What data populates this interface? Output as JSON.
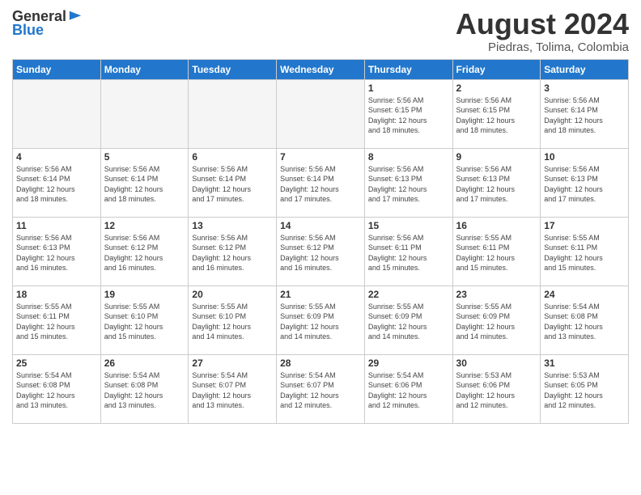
{
  "logo": {
    "general": "General",
    "blue": "Blue"
  },
  "header": {
    "month": "August 2024",
    "location": "Piedras, Tolima, Colombia"
  },
  "weekdays": [
    "Sunday",
    "Monday",
    "Tuesday",
    "Wednesday",
    "Thursday",
    "Friday",
    "Saturday"
  ],
  "weeks": [
    [
      {
        "day": "",
        "info": ""
      },
      {
        "day": "",
        "info": ""
      },
      {
        "day": "",
        "info": ""
      },
      {
        "day": "",
        "info": ""
      },
      {
        "day": "1",
        "info": "Sunrise: 5:56 AM\nSunset: 6:15 PM\nDaylight: 12 hours\nand 18 minutes."
      },
      {
        "day": "2",
        "info": "Sunrise: 5:56 AM\nSunset: 6:15 PM\nDaylight: 12 hours\nand 18 minutes."
      },
      {
        "day": "3",
        "info": "Sunrise: 5:56 AM\nSunset: 6:14 PM\nDaylight: 12 hours\nand 18 minutes."
      }
    ],
    [
      {
        "day": "4",
        "info": "Sunrise: 5:56 AM\nSunset: 6:14 PM\nDaylight: 12 hours\nand 18 minutes."
      },
      {
        "day": "5",
        "info": "Sunrise: 5:56 AM\nSunset: 6:14 PM\nDaylight: 12 hours\nand 18 minutes."
      },
      {
        "day": "6",
        "info": "Sunrise: 5:56 AM\nSunset: 6:14 PM\nDaylight: 12 hours\nand 17 minutes."
      },
      {
        "day": "7",
        "info": "Sunrise: 5:56 AM\nSunset: 6:14 PM\nDaylight: 12 hours\nand 17 minutes."
      },
      {
        "day": "8",
        "info": "Sunrise: 5:56 AM\nSunset: 6:13 PM\nDaylight: 12 hours\nand 17 minutes."
      },
      {
        "day": "9",
        "info": "Sunrise: 5:56 AM\nSunset: 6:13 PM\nDaylight: 12 hours\nand 17 minutes."
      },
      {
        "day": "10",
        "info": "Sunrise: 5:56 AM\nSunset: 6:13 PM\nDaylight: 12 hours\nand 17 minutes."
      }
    ],
    [
      {
        "day": "11",
        "info": "Sunrise: 5:56 AM\nSunset: 6:13 PM\nDaylight: 12 hours\nand 16 minutes."
      },
      {
        "day": "12",
        "info": "Sunrise: 5:56 AM\nSunset: 6:12 PM\nDaylight: 12 hours\nand 16 minutes."
      },
      {
        "day": "13",
        "info": "Sunrise: 5:56 AM\nSunset: 6:12 PM\nDaylight: 12 hours\nand 16 minutes."
      },
      {
        "day": "14",
        "info": "Sunrise: 5:56 AM\nSunset: 6:12 PM\nDaylight: 12 hours\nand 16 minutes."
      },
      {
        "day": "15",
        "info": "Sunrise: 5:56 AM\nSunset: 6:11 PM\nDaylight: 12 hours\nand 15 minutes."
      },
      {
        "day": "16",
        "info": "Sunrise: 5:55 AM\nSunset: 6:11 PM\nDaylight: 12 hours\nand 15 minutes."
      },
      {
        "day": "17",
        "info": "Sunrise: 5:55 AM\nSunset: 6:11 PM\nDaylight: 12 hours\nand 15 minutes."
      }
    ],
    [
      {
        "day": "18",
        "info": "Sunrise: 5:55 AM\nSunset: 6:11 PM\nDaylight: 12 hours\nand 15 minutes."
      },
      {
        "day": "19",
        "info": "Sunrise: 5:55 AM\nSunset: 6:10 PM\nDaylight: 12 hours\nand 15 minutes."
      },
      {
        "day": "20",
        "info": "Sunrise: 5:55 AM\nSunset: 6:10 PM\nDaylight: 12 hours\nand 14 minutes."
      },
      {
        "day": "21",
        "info": "Sunrise: 5:55 AM\nSunset: 6:09 PM\nDaylight: 12 hours\nand 14 minutes."
      },
      {
        "day": "22",
        "info": "Sunrise: 5:55 AM\nSunset: 6:09 PM\nDaylight: 12 hours\nand 14 minutes."
      },
      {
        "day": "23",
        "info": "Sunrise: 5:55 AM\nSunset: 6:09 PM\nDaylight: 12 hours\nand 14 minutes."
      },
      {
        "day": "24",
        "info": "Sunrise: 5:54 AM\nSunset: 6:08 PM\nDaylight: 12 hours\nand 13 minutes."
      }
    ],
    [
      {
        "day": "25",
        "info": "Sunrise: 5:54 AM\nSunset: 6:08 PM\nDaylight: 12 hours\nand 13 minutes."
      },
      {
        "day": "26",
        "info": "Sunrise: 5:54 AM\nSunset: 6:08 PM\nDaylight: 12 hours\nand 13 minutes."
      },
      {
        "day": "27",
        "info": "Sunrise: 5:54 AM\nSunset: 6:07 PM\nDaylight: 12 hours\nand 13 minutes."
      },
      {
        "day": "28",
        "info": "Sunrise: 5:54 AM\nSunset: 6:07 PM\nDaylight: 12 hours\nand 12 minutes."
      },
      {
        "day": "29",
        "info": "Sunrise: 5:54 AM\nSunset: 6:06 PM\nDaylight: 12 hours\nand 12 minutes."
      },
      {
        "day": "30",
        "info": "Sunrise: 5:53 AM\nSunset: 6:06 PM\nDaylight: 12 hours\nand 12 minutes."
      },
      {
        "day": "31",
        "info": "Sunrise: 5:53 AM\nSunset: 6:05 PM\nDaylight: 12 hours\nand 12 minutes."
      }
    ]
  ]
}
